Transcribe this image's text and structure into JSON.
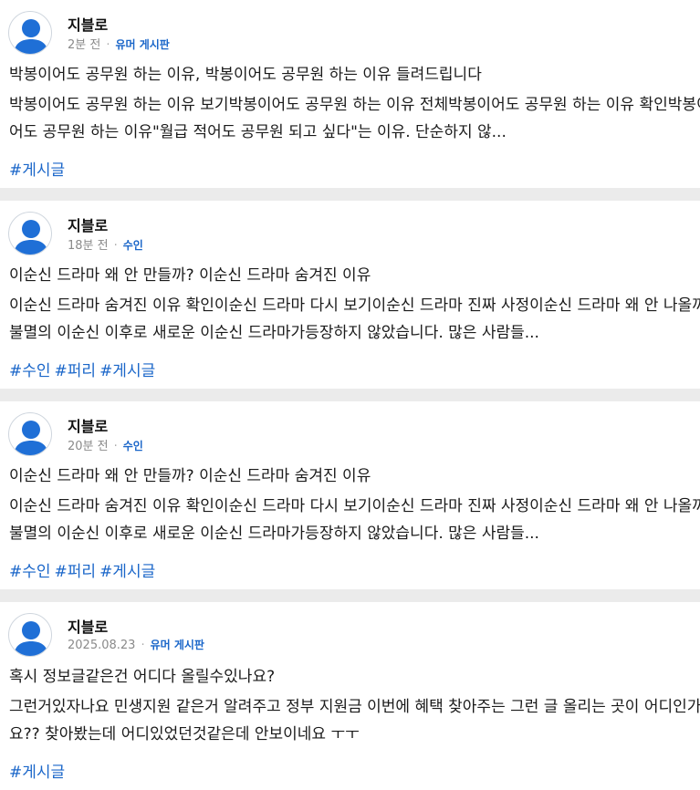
{
  "posts": [
    {
      "author": "지블로",
      "time": "2분 전",
      "board": "유머 게시판",
      "title": "박봉이어도 공무원 하는 이유, 박봉이어도 공무원 하는 이유 들려드립니다",
      "body_line1": "박봉이어도 공무원 하는 이유 보기박봉이어도 공무원 하는 이유 전체박봉이어도 공무원 하는 이유 확인박봉이",
      "body_line2": "어도 공무원 하는 이유\"월급 적어도 공무원 되고 싶다\"는 이유. 단순하지 않...",
      "tags": [
        "#게시글"
      ]
    },
    {
      "author": "지블로",
      "time": "18분 전",
      "board": "수인",
      "title": "이순신 드라마 왜 안 만들까? 이순신 드라마 숨겨진 이유",
      "body_line1": "이순신 드라마 숨겨진 이유 확인이순신 드라마 다시 보기이순신 드라마 진짜 사정이순신 드라마 왜 안 나올까",
      "body_line2": "불멸의 이순신 이후로 새로운 이순신 드라마가등장하지 않았습니다. 많은 사람들...",
      "tags": [
        "#수인",
        "#퍼리",
        "#게시글"
      ]
    },
    {
      "author": "지블로",
      "time": "20분 전",
      "board": "수인",
      "title": "이순신 드라마 왜 안 만들까? 이순신 드라마 숨겨진 이유",
      "body_line1": "이순신 드라마 숨겨진 이유 확인이순신 드라마 다시 보기이순신 드라마 진짜 사정이순신 드라마 왜 안 나올까",
      "body_line2": "불멸의 이순신 이후로 새로운 이순신 드라마가등장하지 않았습니다. 많은 사람들...",
      "tags": [
        "#수인",
        "#퍼리",
        "#게시글"
      ]
    },
    {
      "author": "지블로",
      "time": "2025.08.23",
      "board": "유머 게시판",
      "title": "혹시 정보글같은건 어디다 올릴수있나요?",
      "body_line1": "그런거있자나요 민생지원 같은거 알려주고 정부 지원금 이번에 혜택 찾아주는 그런 글 올리는 곳이 어디인가",
      "body_line2": "요?? 찾아봤는데 어디있었던것같은데 안보이네요 ㅜㅜ",
      "tags": [
        "#게시글"
      ]
    }
  ],
  "colors": {
    "accent": "#1a66c9",
    "avatar": "#1f6fd6",
    "separator": "#ebebeb"
  },
  "icons": {
    "avatar": "user-avatar-icon"
  }
}
